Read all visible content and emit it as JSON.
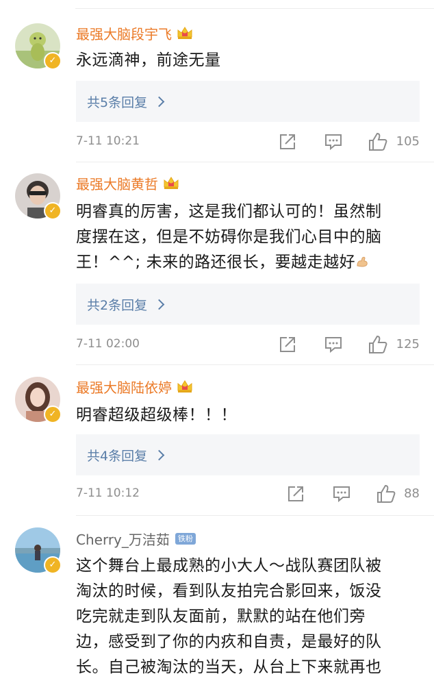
{
  "comments": [
    {
      "username": "最强大脑段宇飞",
      "verified": true,
      "content": [
        "永远滴神，前途无量"
      ],
      "replies_label": "共5条回复",
      "timestamp": "7-11 10:21",
      "likes": "105"
    },
    {
      "username": "最强大脑黄哲",
      "verified": true,
      "content": [
        "明睿真的厉害，这是我们都认可的！虽然制",
        "度摆在这，但是不妨碍你是我们心目中的脑",
        "王！^^; 未来的路还很长，要越走越好"
      ],
      "replies_label": "共2条回复",
      "timestamp": "7-11 02:00",
      "likes": "125"
    },
    {
      "username": "最强大脑陆依婷",
      "verified": true,
      "content": [
        "明睿超级超级棒！！！"
      ],
      "replies_label": "共4条回复",
      "timestamp": "7-11 10:12",
      "likes": "88"
    },
    {
      "username": "Cherry_万洁茹",
      "badge": "铁粉",
      "verified": true,
      "content": [
        "这个舞台上最成熟的小大人～战队赛团队被",
        "淘汰的时候，看到队友拍完合影回来，饭没",
        "吃完就走到队友面前，默默的站在他们旁",
        "边，感受到了你的内疚和自责，是最好的队",
        "长。自己被淘汰的当天，从台上下来就再也"
      ]
    }
  ],
  "colors": {
    "username": "#eb7a27",
    "reply_link": "#5a7ea8",
    "reply_bg": "#f5f6f8",
    "meta_text": "#8e8e8e",
    "verified_badge": "#f0b424"
  },
  "icons": {
    "share": "share-icon",
    "comment": "comment-icon",
    "like": "thumbs-up-icon",
    "crown": "crown-icon",
    "muscle": "flexed-biceps-icon"
  }
}
